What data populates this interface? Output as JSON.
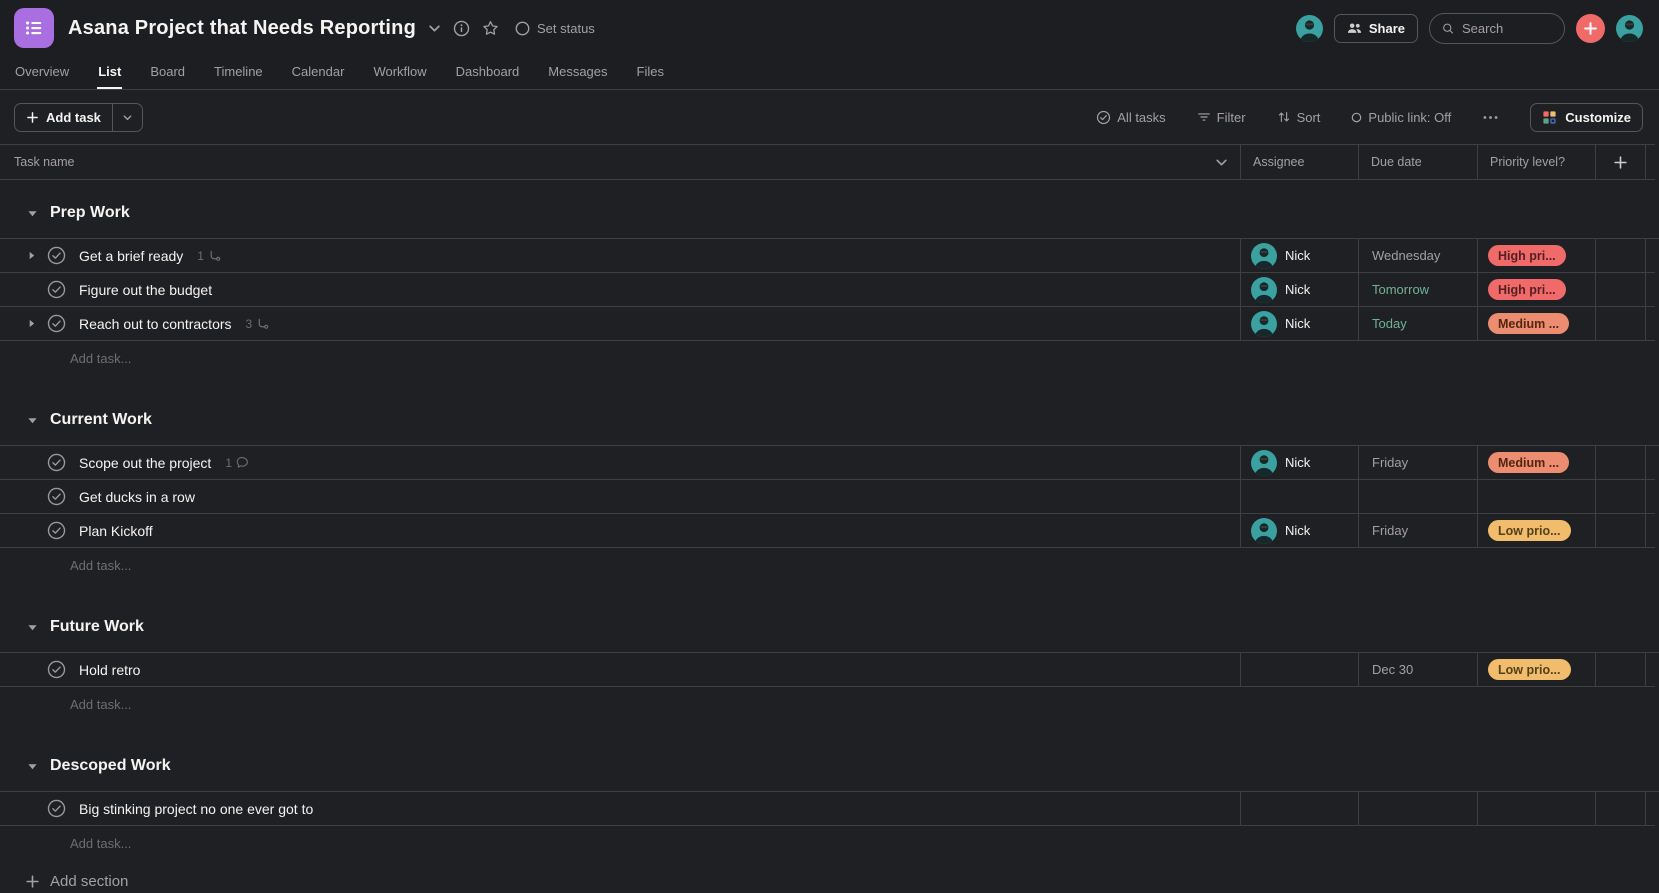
{
  "topbar": {
    "title": "Asana Project that Needs Reporting",
    "set_status_label": "Set status",
    "share_label": "Share",
    "search_placeholder": "Search"
  },
  "tabs": {
    "active": "List",
    "items": [
      {
        "label": "Overview"
      },
      {
        "label": "List"
      },
      {
        "label": "Board"
      },
      {
        "label": "Timeline"
      },
      {
        "label": "Calendar"
      },
      {
        "label": "Workflow"
      },
      {
        "label": "Dashboard"
      },
      {
        "label": "Messages"
      },
      {
        "label": "Files"
      }
    ]
  },
  "toolbar": {
    "add_task_label": "Add task",
    "all_tasks_label": "All tasks",
    "filter_label": "Filter",
    "sort_label": "Sort",
    "public_link_label": "Public link: Off",
    "customize_label": "Customize"
  },
  "table": {
    "columns": [
      {
        "label": "Task name"
      },
      {
        "label": "Assignee"
      },
      {
        "label": "Due date"
      },
      {
        "label": "Priority level?"
      }
    ]
  },
  "labels": {
    "add_task_row": "Add task...",
    "add_section": "Add section"
  },
  "sections": [
    {
      "name": "Prep Work",
      "tasks": [
        {
          "name": "Get a brief ready",
          "expandable": true,
          "subtask_count": "1",
          "comment_count": null,
          "assignee": "Nick",
          "due": "Wednesday",
          "due_soon": false,
          "priority": {
            "label": "High pri...",
            "level": "high"
          }
        },
        {
          "name": "Figure out the budget",
          "expandable": false,
          "subtask_count": null,
          "comment_count": null,
          "assignee": "Nick",
          "due": "Tomorrow",
          "due_soon": true,
          "priority": {
            "label": "High pri...",
            "level": "high"
          }
        },
        {
          "name": "Reach out to contractors",
          "expandable": true,
          "subtask_count": "3",
          "comment_count": null,
          "assignee": "Nick",
          "due": "Today",
          "due_soon": true,
          "priority": {
            "label": "Medium ...",
            "level": "medium"
          }
        }
      ]
    },
    {
      "name": "Current Work",
      "tasks": [
        {
          "name": "Scope out the project",
          "expandable": false,
          "subtask_count": null,
          "comment_count": "1",
          "assignee": "Nick",
          "due": "Friday",
          "due_soon": false,
          "priority": {
            "label": "Medium ...",
            "level": "medium"
          }
        },
        {
          "name": "Get ducks in a row",
          "expandable": false,
          "subtask_count": null,
          "comment_count": null,
          "assignee": null,
          "due": "",
          "due_soon": false,
          "priority": null
        },
        {
          "name": "Plan Kickoff",
          "expandable": false,
          "subtask_count": null,
          "comment_count": null,
          "assignee": "Nick",
          "due": "Friday",
          "due_soon": false,
          "priority": {
            "label": "Low prio...",
            "level": "low"
          }
        }
      ]
    },
    {
      "name": "Future Work",
      "tasks": [
        {
          "name": "Hold retro",
          "expandable": false,
          "subtask_count": null,
          "comment_count": null,
          "assignee": null,
          "due": "Dec 30",
          "due_soon": false,
          "priority": {
            "label": "Low prio...",
            "level": "low"
          }
        }
      ]
    },
    {
      "name": "Descoped Work",
      "tasks": [
        {
          "name": "Big stinking project no one ever got to",
          "expandable": false,
          "subtask_count": null,
          "comment_count": null,
          "assignee": null,
          "due": "",
          "due_soon": false,
          "priority": null
        }
      ]
    }
  ],
  "colors": {
    "logo_purple": "#a96ee0",
    "accent_coral": "#f06a6a",
    "avatar_teal": "#3aa0a0",
    "due_soon_green": "#72b193",
    "priority": {
      "high": {
        "bg": "#f06a6a",
        "text": "#531f23"
      },
      "medium": {
        "bg": "#ec8d71",
        "text": "#53260f"
      },
      "low": {
        "bg": "#f1bd6c",
        "text": "#544016"
      }
    },
    "customize_grid": {
      "tl": "#f06a6a",
      "tr": "#f1bd6c",
      "bl": "#5da283",
      "br": "#4573d2"
    }
  }
}
